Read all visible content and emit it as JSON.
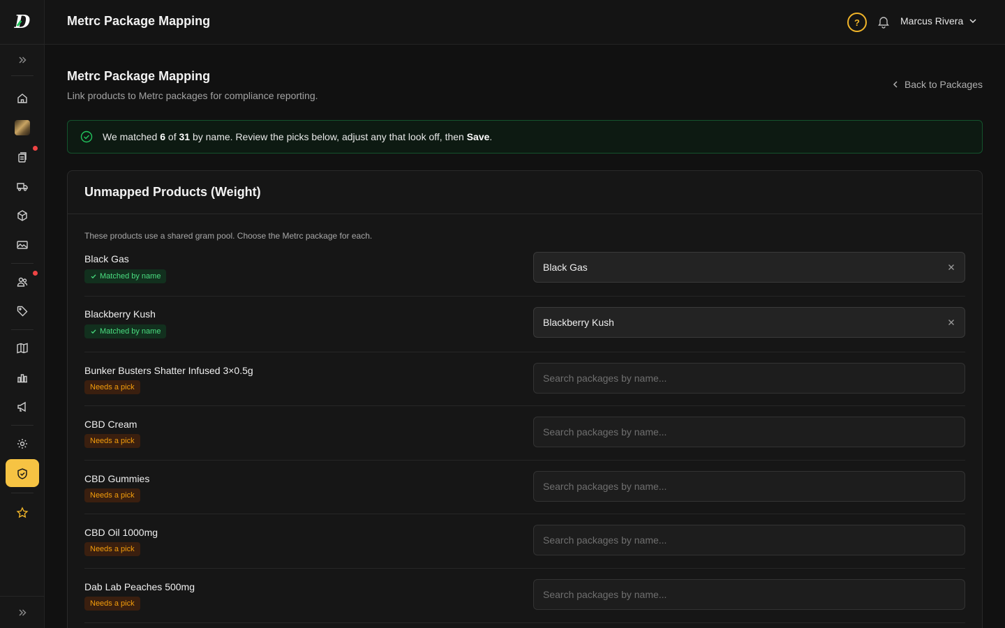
{
  "header": {
    "title": "Metrc Package Mapping",
    "help_glyph": "?",
    "user_name": "Marcus Rivera"
  },
  "page": {
    "title": "Metrc Package Mapping",
    "subtitle": "Link products to Metrc packages for compliance reporting.",
    "back_label": "Back to Packages"
  },
  "banner": {
    "pre": "We matched ",
    "matched": "6",
    "mid": " of ",
    "total": "31",
    "post": " by name. Review the picks below, adjust any that look off, then ",
    "action": "Save",
    "end": "."
  },
  "section": {
    "title": "Unmapped Products (Weight)",
    "note": "These products use a shared gram pool. Choose the Metrc package for each.",
    "search_placeholder": "Search packages by name..."
  },
  "rows": [
    {
      "name": "Black Gas",
      "status": "matched",
      "badge": "Matched by name",
      "package": "Black Gas"
    },
    {
      "name": "Blackberry Kush",
      "status": "matched",
      "badge": "Matched by name",
      "package": "Blackberry Kush"
    },
    {
      "name": "Bunker Busters Shatter Infused 3×0.5g",
      "status": "needs",
      "badge": "Needs a pick",
      "package": ""
    },
    {
      "name": "CBD Cream",
      "status": "needs",
      "badge": "Needs a pick",
      "package": ""
    },
    {
      "name": "CBD Gummies",
      "status": "needs",
      "badge": "Needs a pick",
      "package": ""
    },
    {
      "name": "CBD Oil 1000mg",
      "status": "needs",
      "badge": "Needs a pick",
      "package": ""
    },
    {
      "name": "Dab Lab Peaches 500mg",
      "status": "needs",
      "badge": "Needs a pick",
      "package": ""
    }
  ],
  "sidebar": {
    "items": [
      {
        "name": "home-icon",
        "alert": false
      },
      {
        "name": "store-thumbnail",
        "alert": false
      },
      {
        "name": "orders-icon",
        "alert": true
      },
      {
        "name": "delivery-truck-icon",
        "alert": false
      },
      {
        "name": "package-box-icon",
        "alert": false
      },
      {
        "name": "media-image-icon",
        "alert": false
      },
      {
        "name": "customers-icon",
        "alert": true
      },
      {
        "name": "tag-icon",
        "alert": false
      },
      {
        "name": "book-icon",
        "alert": false
      },
      {
        "name": "analytics-chart-icon",
        "alert": false
      },
      {
        "name": "megaphone-icon",
        "alert": false
      },
      {
        "name": "settings-gear-icon",
        "alert": false
      },
      {
        "name": "compliance-shield-icon",
        "alert": false,
        "active": true
      },
      {
        "name": "star-icon",
        "alert": false
      }
    ]
  },
  "colors": {
    "accent": "#f6c343",
    "matched_green": "#4ade80",
    "needs_amber": "#f59e0b",
    "alert_red": "#ef4444"
  }
}
